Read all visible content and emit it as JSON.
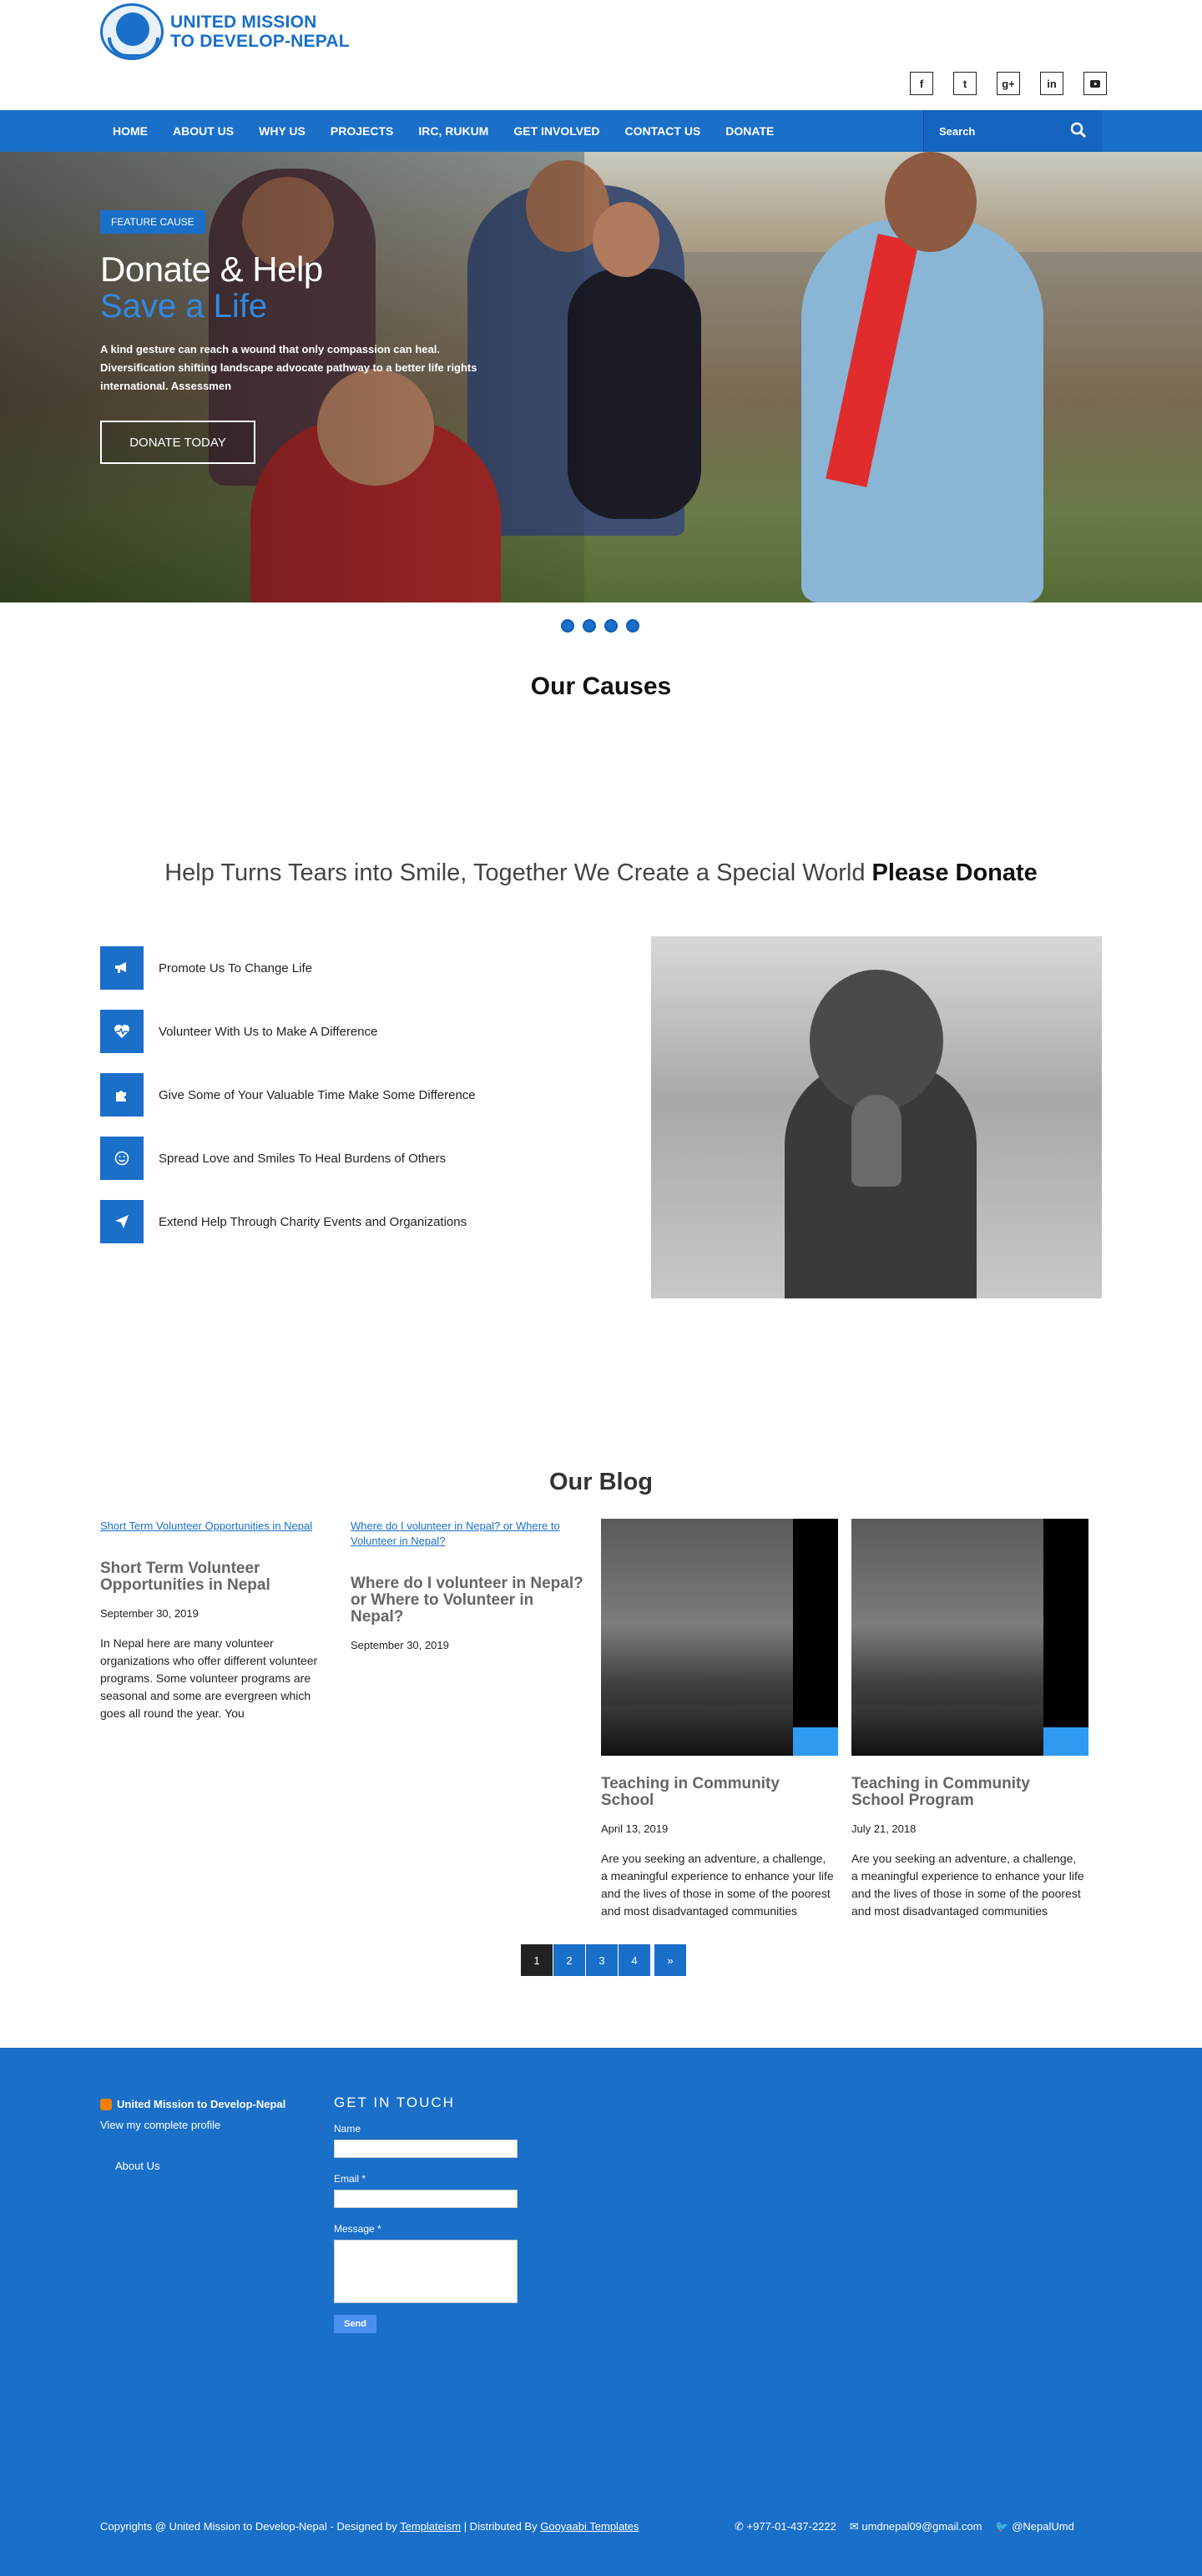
{
  "brand": {
    "line1": "UNITED MISSION",
    "line2": "TO DEVELOP-NEPAL",
    "accent": "#1a6fc9"
  },
  "social": [
    "f",
    "t",
    "g+",
    "in",
    "yt"
  ],
  "nav": {
    "items": [
      "HOME",
      "ABOUT US",
      "WHY US",
      "PROJECTS",
      "IRC, RUKUM",
      "GET INVOLVED",
      "CONTACT US",
      "DONATE"
    ],
    "search_placeholder": "Search"
  },
  "hero": {
    "badge": "FEATURE CAUSE",
    "title": "Donate & Help",
    "subtitle": "Save a Life",
    "text": "A kind gesture can reach a wound that only compassion can heal. Diversification shifting landscape advocate pathway to a better life rights international. Assessmen",
    "button": "DONATE TODAY"
  },
  "slider_dots": 4,
  "causes": {
    "title": "Our Causes"
  },
  "donate": {
    "heading": "Help Turns Tears into Smile, Together We Create a Special World",
    "heading_bold": "Please Donate",
    "items": [
      {
        "icon": "megaphone-icon",
        "glyph": "📢",
        "text": "Promote Us To Change Life"
      },
      {
        "icon": "heart-pulse-icon",
        "glyph": "♥",
        "text": "Volunteer With Us to Make A Difference"
      },
      {
        "icon": "puzzle-icon",
        "glyph": "✚",
        "text": "Give Some of Your Valuable Time Make Some Difference"
      },
      {
        "icon": "smile-icon",
        "glyph": "☺",
        "text": "Spread Love and Smiles To Heal Burdens of Others"
      },
      {
        "icon": "paper-plane-icon",
        "glyph": "➤",
        "text": "Extend Help Through Charity Events and Organizations"
      }
    ]
  },
  "blog": {
    "title": "Our Blog",
    "posts": [
      {
        "image_alt": "Short Term Volunteer Opportunities in Nepal",
        "title": "Short Term Volunteer Opportunities in Nepal",
        "date": "September 30, 2019",
        "excerpt": "In Nepal here are many volunteer organizations who offer different volunteer programs. Some volunteer programs are seasonal and some are evergreen which goes all round the year. You"
      },
      {
        "image_alt": "Where do I volunteer in Nepal? or Where to Volunteer in Nepal?",
        "title": "Where do I volunteer in Nepal? or Where to Volunteer in Nepal?",
        "date": "September 30, 2019",
        "excerpt": ""
      },
      {
        "title": "Teaching in Community School",
        "date": "April 13, 2019",
        "excerpt": "Are you seeking an adventure, a challenge, a meaningful experience to enhance your life and the lives of those in some of the poorest and most disadvantaged communities"
      },
      {
        "title": "Teaching in Community School Program",
        "date": "July 21, 2018",
        "excerpt": "Are you seeking an adventure, a challenge, a meaningful experience to enhance your life and the lives of those in some of the poorest and most disadvantaged communities"
      }
    ],
    "pagination": [
      "1",
      "2",
      "3",
      "4",
      "»"
    ]
  },
  "footer": {
    "profile_name": "United Mission to Develop-Nepal",
    "profile_link": "View my complete profile",
    "about": "About Us",
    "contact_title": "GET IN TOUCH",
    "name_label": "Name",
    "email_label": "Email *",
    "message_label": "Message *",
    "send": "Send",
    "copyright_prefix": "Copyrights @ United Mission to Develop-Nepal - Designed by",
    "designer": "Templateism",
    "distributed_prefix": "| Distributed By",
    "distributor": "Gooyaabi Templates",
    "phone": "+977-01-437-2222",
    "email": "umdnepal09@gmail.com",
    "twitter": "@NepalUmd"
  }
}
